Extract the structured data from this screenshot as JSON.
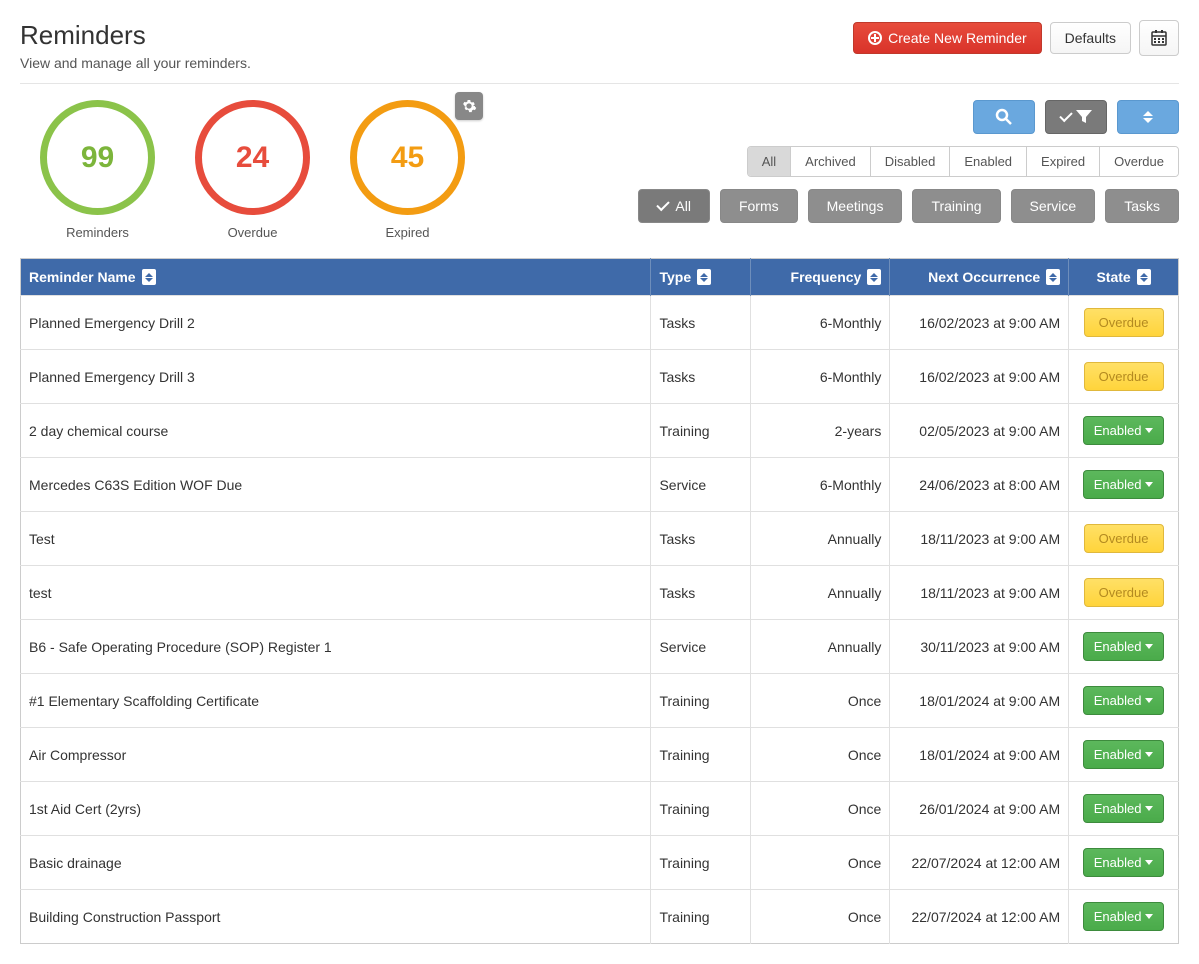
{
  "header": {
    "title": "Reminders",
    "subtitle": "View and manage all your reminders.",
    "create_btn": "Create New Reminder",
    "defaults_btn": "Defaults"
  },
  "stats": [
    {
      "value": "99",
      "label": "Reminders",
      "color": "green"
    },
    {
      "value": "24",
      "label": "Overdue",
      "color": "red"
    },
    {
      "value": "45",
      "label": "Expired",
      "color": "orange"
    }
  ],
  "state_tabs": [
    "All",
    "Archived",
    "Disabled",
    "Enabled",
    "Expired",
    "Overdue"
  ],
  "type_filters": [
    "All",
    "Forms",
    "Meetings",
    "Training",
    "Service",
    "Tasks"
  ],
  "columns": {
    "name": "Reminder Name",
    "type": "Type",
    "freq": "Frequency",
    "next": "Next Occurrence",
    "state": "State"
  },
  "badges": {
    "overdue": "Overdue",
    "enabled": "Enabled"
  },
  "rows": [
    {
      "name": "Planned Emergency Drill 2",
      "type": "Tasks",
      "freq": "6-Monthly",
      "next": "16/02/2023 at 9:00 AM",
      "state": "overdue"
    },
    {
      "name": "Planned Emergency Drill 3",
      "type": "Tasks",
      "freq": "6-Monthly",
      "next": "16/02/2023 at 9:00 AM",
      "state": "overdue"
    },
    {
      "name": "2 day chemical course",
      "type": "Training",
      "freq": "2-years",
      "next": "02/05/2023 at 9:00 AM",
      "state": "enabled"
    },
    {
      "name": "Mercedes C63S Edition WOF Due",
      "type": "Service",
      "freq": "6-Monthly",
      "next": "24/06/2023 at 8:00 AM",
      "state": "enabled"
    },
    {
      "name": "Test",
      "type": "Tasks",
      "freq": "Annually",
      "next": "18/11/2023 at 9:00 AM",
      "state": "overdue"
    },
    {
      "name": "test",
      "type": "Tasks",
      "freq": "Annually",
      "next": "18/11/2023 at 9:00 AM",
      "state": "overdue"
    },
    {
      "name": "B6 - Safe Operating Procedure (SOP) Register 1",
      "type": "Service",
      "freq": "Annually",
      "next": "30/11/2023 at 9:00 AM",
      "state": "enabled"
    },
    {
      "name": "#1 Elementary Scaffolding Certificate",
      "type": "Training",
      "freq": "Once",
      "next": "18/01/2024 at 9:00 AM",
      "state": "enabled"
    },
    {
      "name": "Air Compressor",
      "type": "Training",
      "freq": "Once",
      "next": "18/01/2024 at 9:00 AM",
      "state": "enabled"
    },
    {
      "name": "1st Aid Cert (2yrs)",
      "type": "Training",
      "freq": "Once",
      "next": "26/01/2024 at 9:00 AM",
      "state": "enabled"
    },
    {
      "name": "Basic drainage",
      "type": "Training",
      "freq": "Once",
      "next": "22/07/2024 at 12:00 AM",
      "state": "enabled"
    },
    {
      "name": "Building Construction Passport",
      "type": "Training",
      "freq": "Once",
      "next": "22/07/2024 at 12:00 AM",
      "state": "enabled"
    }
  ]
}
